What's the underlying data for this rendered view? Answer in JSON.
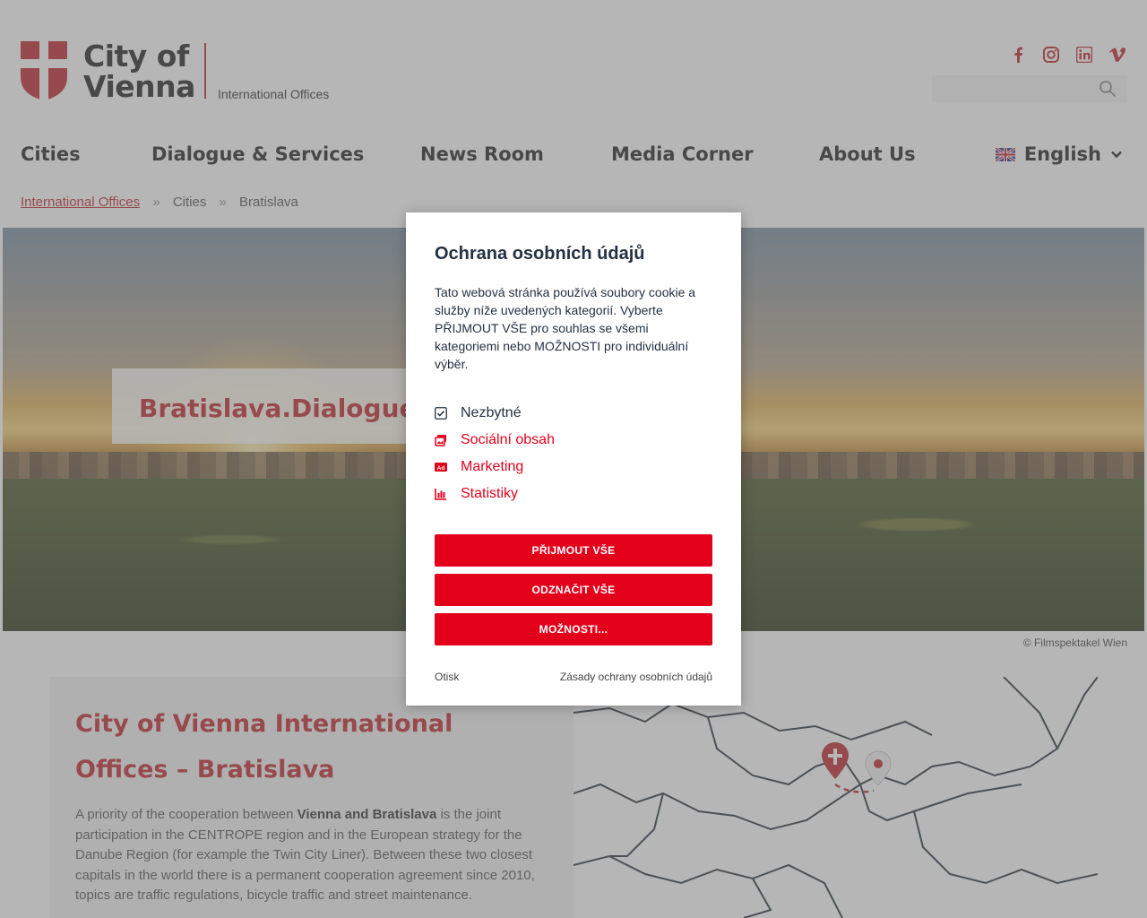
{
  "header": {
    "logo_line1": "City of",
    "logo_line2": "Vienna",
    "logo_sub": "International Offices",
    "social": [
      "facebook-icon",
      "instagram-icon",
      "linkedin-icon",
      "vimeo-icon"
    ],
    "search_placeholder": ""
  },
  "nav": {
    "items": [
      "Cities",
      "Dialogue & Services",
      "News Room",
      "Media Corner",
      "About Us"
    ],
    "language": "English"
  },
  "breadcrumb": {
    "items": [
      "International Offices",
      "Cities",
      "Bratislava"
    ],
    "separator": "»"
  },
  "hero": {
    "label": "Bratislava.Dialogue.F",
    "credit": "© Filmspektakel Wien"
  },
  "content": {
    "title": "City of Vienna International Offices – Bratislava",
    "body_1": "A priority of the cooperation between ",
    "body_bold": "Vienna and Bratislava",
    "body_2": " is the joint participation in the CENTROPE region and in the European strategy for the Danube Region (for example the Twin City Liner). Between these two closest capitals in the world there is a permanent cooperation agreement since 2010, topics are traffic regulations, bicycle traffic and street maintenance."
  },
  "modal": {
    "title": "Ochrana osobních údajů",
    "description": "Tato webová stránka používá soubory cookie a služby níže uvedených kategorií. Vyberte PŘIJMOUT VŠE pro souhlas se všemi kategoriemi nebo MOŽNOSTI pro individuální výběr.",
    "categories": [
      "Nezbytné",
      "Sociální obsah",
      "Marketing",
      "Statistiky"
    ],
    "btn_accept": "PŘIJMOUT VŠE",
    "btn_deselect": "ODZNAČIT VŠE",
    "btn_options": "MOŽNOSTI...",
    "link_imprint": "Otisk",
    "link_privacy": "Zásady ochrany osobních údajů"
  },
  "colors": {
    "brand_red": "#c0272d",
    "button_red": "#e3001b",
    "overlay": "rgba(110,110,110,0.5)"
  }
}
